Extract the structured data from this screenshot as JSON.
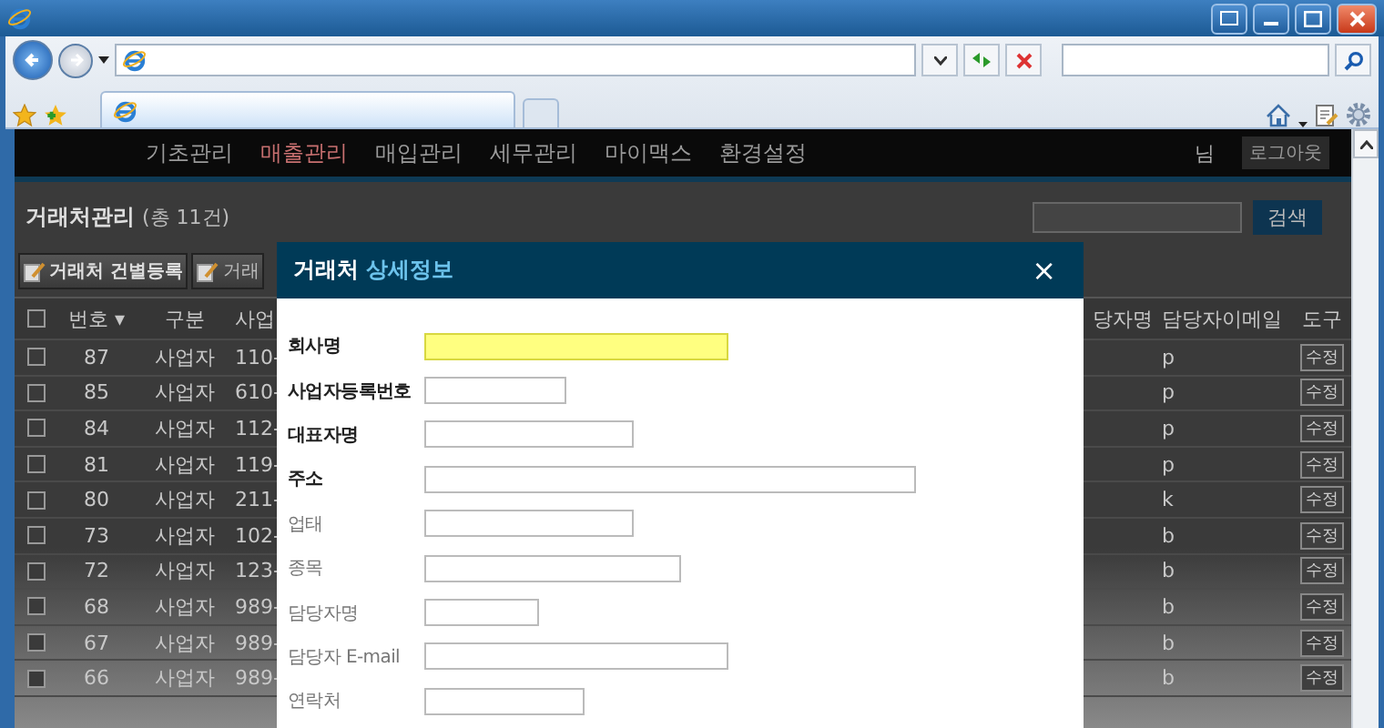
{
  "nav": {
    "items": [
      {
        "label": "기초관리",
        "selected": false
      },
      {
        "label": "매출관리",
        "selected": true
      },
      {
        "label": "매입관리",
        "selected": false
      },
      {
        "label": "세무관리",
        "selected": false
      },
      {
        "label": "마이맥스",
        "selected": false
      },
      {
        "label": "환경설정",
        "selected": false
      }
    ],
    "user_suffix": "님",
    "logout": "로그아웃"
  },
  "page": {
    "title": "거래처관리",
    "count": "(총 11건)",
    "search_button": "검색"
  },
  "toolbar": [
    "거래처 건별등록",
    "거래"
  ],
  "table": {
    "all_checked": false,
    "columns_left": [
      "번호",
      "구분",
      "사업"
    ],
    "sort_mark": "▾",
    "columns_right": [
      "당자명",
      "담당자이메일",
      "도구"
    ],
    "rows": [
      {
        "checked": false,
        "number": "87",
        "type": "사업자",
        "column_4": "110-",
        "column_6": "p",
        "tool": "수정"
      },
      {
        "checked": false,
        "number": "85",
        "type": "사업자",
        "column_4": "610-",
        "column_6": "p",
        "tool": "수정"
      },
      {
        "checked": false,
        "number": "84",
        "type": "사업자",
        "column_4": "112-",
        "column_6": "p",
        "tool": "수정"
      },
      {
        "checked": false,
        "number": "81",
        "type": "사업자",
        "column_4": "119-",
        "column_6": "p",
        "tool": "수정"
      },
      {
        "checked": false,
        "number": "80",
        "type": "사업자",
        "column_4": "211-",
        "column_6": "k",
        "tool": "수정"
      },
      {
        "checked": false,
        "number": "73",
        "type": "사업자",
        "column_4": "102-",
        "column_6": "b",
        "tool": "수정"
      },
      {
        "checked": false,
        "number": "72",
        "type": "사업자",
        "column_4": "123-",
        "column_6": "b",
        "tool": "수정"
      },
      {
        "checked": false,
        "number": "68",
        "type": "사업자",
        "column_4": "989-",
        "column_6": "b",
        "tool": "수정"
      },
      {
        "checked": false,
        "number": "67",
        "type": "사업자",
        "column_4": "989-",
        "column_6": "b",
        "tool": "수정"
      },
      {
        "checked": false,
        "number": "66",
        "type": "사업자",
        "column_4": "989-",
        "column_6": "b",
        "tool": "수정"
      }
    ]
  },
  "modal": {
    "title": "거래처",
    "subtitle": "상세정보",
    "close": "×",
    "fields": [
      {
        "label": "회사명",
        "required": true,
        "focused": true
      },
      {
        "label": "사업자등록번호",
        "required": true,
        "focused": false
      },
      {
        "label": "대표자명",
        "required": true,
        "focused": false
      },
      {
        "label": "주소",
        "required": true,
        "focused": false
      },
      {
        "label": "업태",
        "required": false,
        "focused": false
      },
      {
        "label": "종목",
        "required": false,
        "focused": false
      },
      {
        "label": "담당자명",
        "required": false,
        "focused": false
      },
      {
        "label": "담당자 E-mail",
        "required": false,
        "focused": false
      },
      {
        "label": "연락처",
        "required": false,
        "focused": false
      }
    ]
  }
}
